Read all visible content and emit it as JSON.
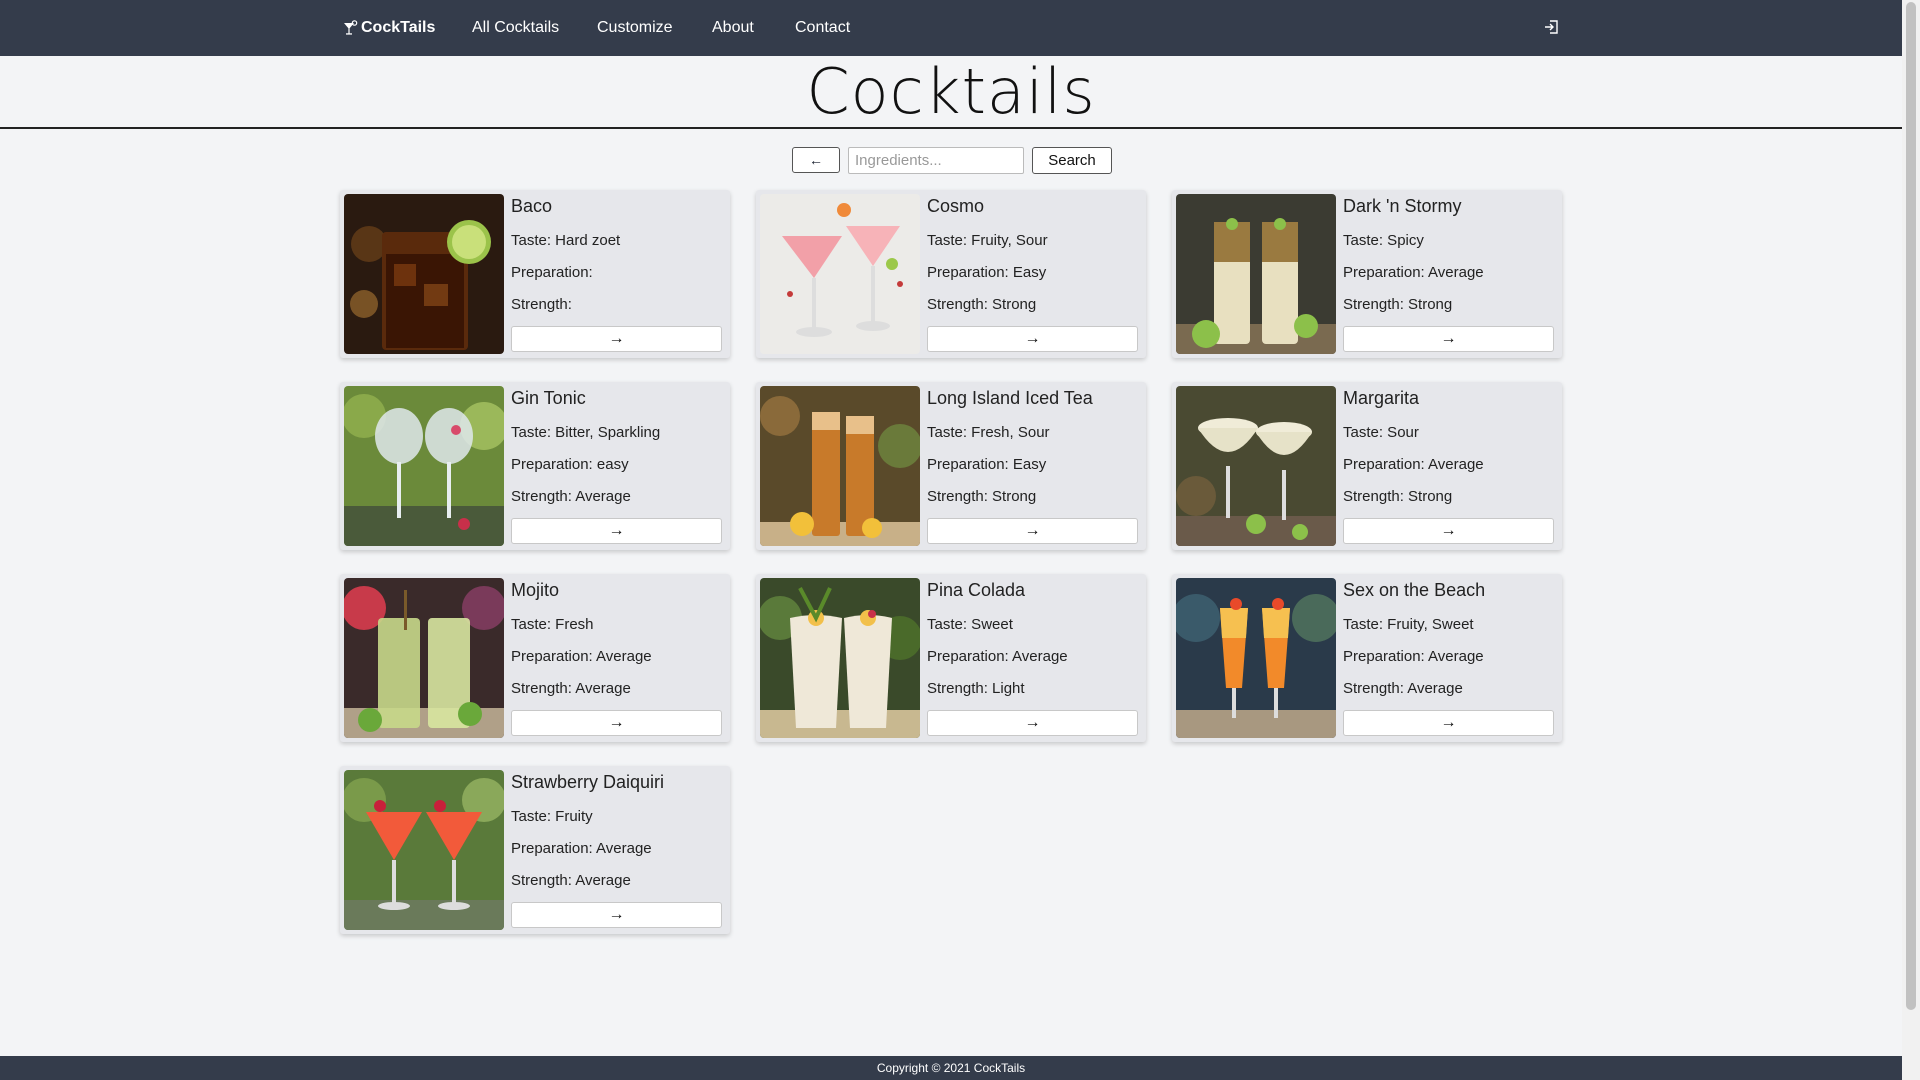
{
  "nav": {
    "brand": "CockTails",
    "links": [
      "All Cocktails",
      "Customize",
      "About",
      "Contact"
    ]
  },
  "page": {
    "title": "Cocktails"
  },
  "search": {
    "back_label": "←",
    "placeholder": "Ingredients...",
    "button_label": "Search"
  },
  "cards": [
    {
      "name": "Baco",
      "taste": "Taste: Hard zoet",
      "prep": "Preparation:",
      "strength": "Strength:",
      "arrow": "→"
    },
    {
      "name": "Cosmo",
      "taste": "Taste: Fruity, Sour",
      "prep": "Preparation: Easy",
      "strength": "Strength: Strong",
      "arrow": "→"
    },
    {
      "name": "Dark 'n Stormy",
      "taste": "Taste: Spicy",
      "prep": "Preparation: Average",
      "strength": "Strength: Strong",
      "arrow": "→"
    },
    {
      "name": "Gin Tonic",
      "taste": "Taste: Bitter, Sparkling",
      "prep": "Preparation: easy",
      "strength": "Strength: Average",
      "arrow": "→"
    },
    {
      "name": "Long Island Iced Tea",
      "taste": "Taste: Fresh, Sour",
      "prep": "Preparation: Easy",
      "strength": "Strength: Strong",
      "arrow": "→"
    },
    {
      "name": "Margarita",
      "taste": "Taste: Sour",
      "prep": "Preparation: Average",
      "strength": "Strength: Strong",
      "arrow": "→"
    },
    {
      "name": "Mojito",
      "taste": "Taste: Fresh",
      "prep": "Preparation: Average",
      "strength": "Strength: Average",
      "arrow": "→"
    },
    {
      "name": "Pina Colada",
      "taste": "Taste: Sweet",
      "prep": "Preparation: Average",
      "strength": "Strength: Light",
      "arrow": "→"
    },
    {
      "name": "Sex on the Beach",
      "taste": "Taste: Fruity, Sweet",
      "prep": "Preparation: Average",
      "strength": "Strength: Average",
      "arrow": "→"
    },
    {
      "name": "Strawberry Daiquiri",
      "taste": "Taste: Fruity",
      "prep": "Preparation: Average",
      "strength": "Strength: Average",
      "arrow": "→"
    }
  ],
  "footer": {
    "text": "Copyright © 2021 CockTails"
  },
  "colors": {
    "navbar": "#343c4b",
    "card": "#e6e7eb",
    "background": "#f3f4f6"
  },
  "icons": {
    "brand": "cocktail-glass-icon",
    "logout": "logout-icon"
  }
}
